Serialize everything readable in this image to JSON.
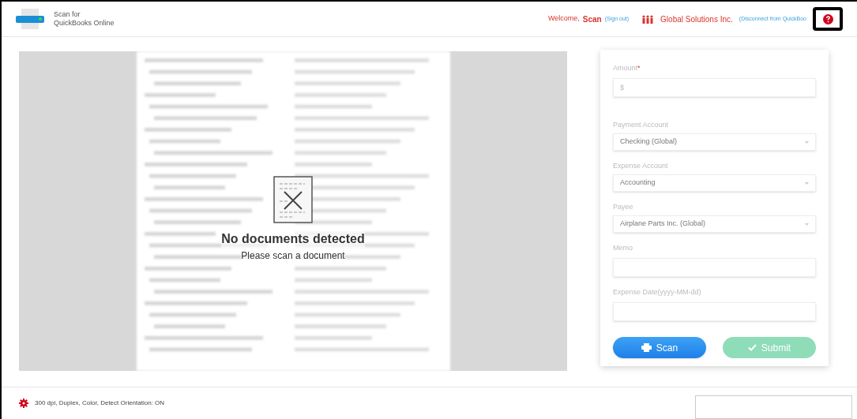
{
  "header": {
    "app_name_line1": "Scan for",
    "app_name_line2": "QuickBooks Online",
    "welcome": "Welcome,",
    "user": "Scan",
    "sign_out": "(Sign out)",
    "company": "Global Solutions Inc.",
    "disconnect": "(Disconnect from QuickBoo"
  },
  "preview": {
    "title": "No documents detected",
    "subtitle": "Please scan a document"
  },
  "form": {
    "fields": [
      {
        "kind": "input",
        "label": "Amount",
        "required_mark": "*",
        "placeholder": "$"
      },
      {
        "kind": "select",
        "label": "Payment Account",
        "value": "Checking (Global)"
      },
      {
        "kind": "select",
        "label": "Expense Account",
        "value": "Accounting"
      },
      {
        "kind": "select",
        "label": "Payee",
        "value": "Airplane Parts Inc. (Global)"
      },
      {
        "kind": "input",
        "label": "Memo"
      },
      {
        "kind": "input",
        "label": "Expense Date(yyyy-MM-dd)"
      }
    ],
    "scan_button": {
      "label": "Scan",
      "disabled": false
    },
    "submit_button": {
      "label": "Submit",
      "disabled": true
    }
  },
  "status_bar": {
    "settings": "300 dpi, Duplex, Color, Detect Orientation: ON"
  }
}
